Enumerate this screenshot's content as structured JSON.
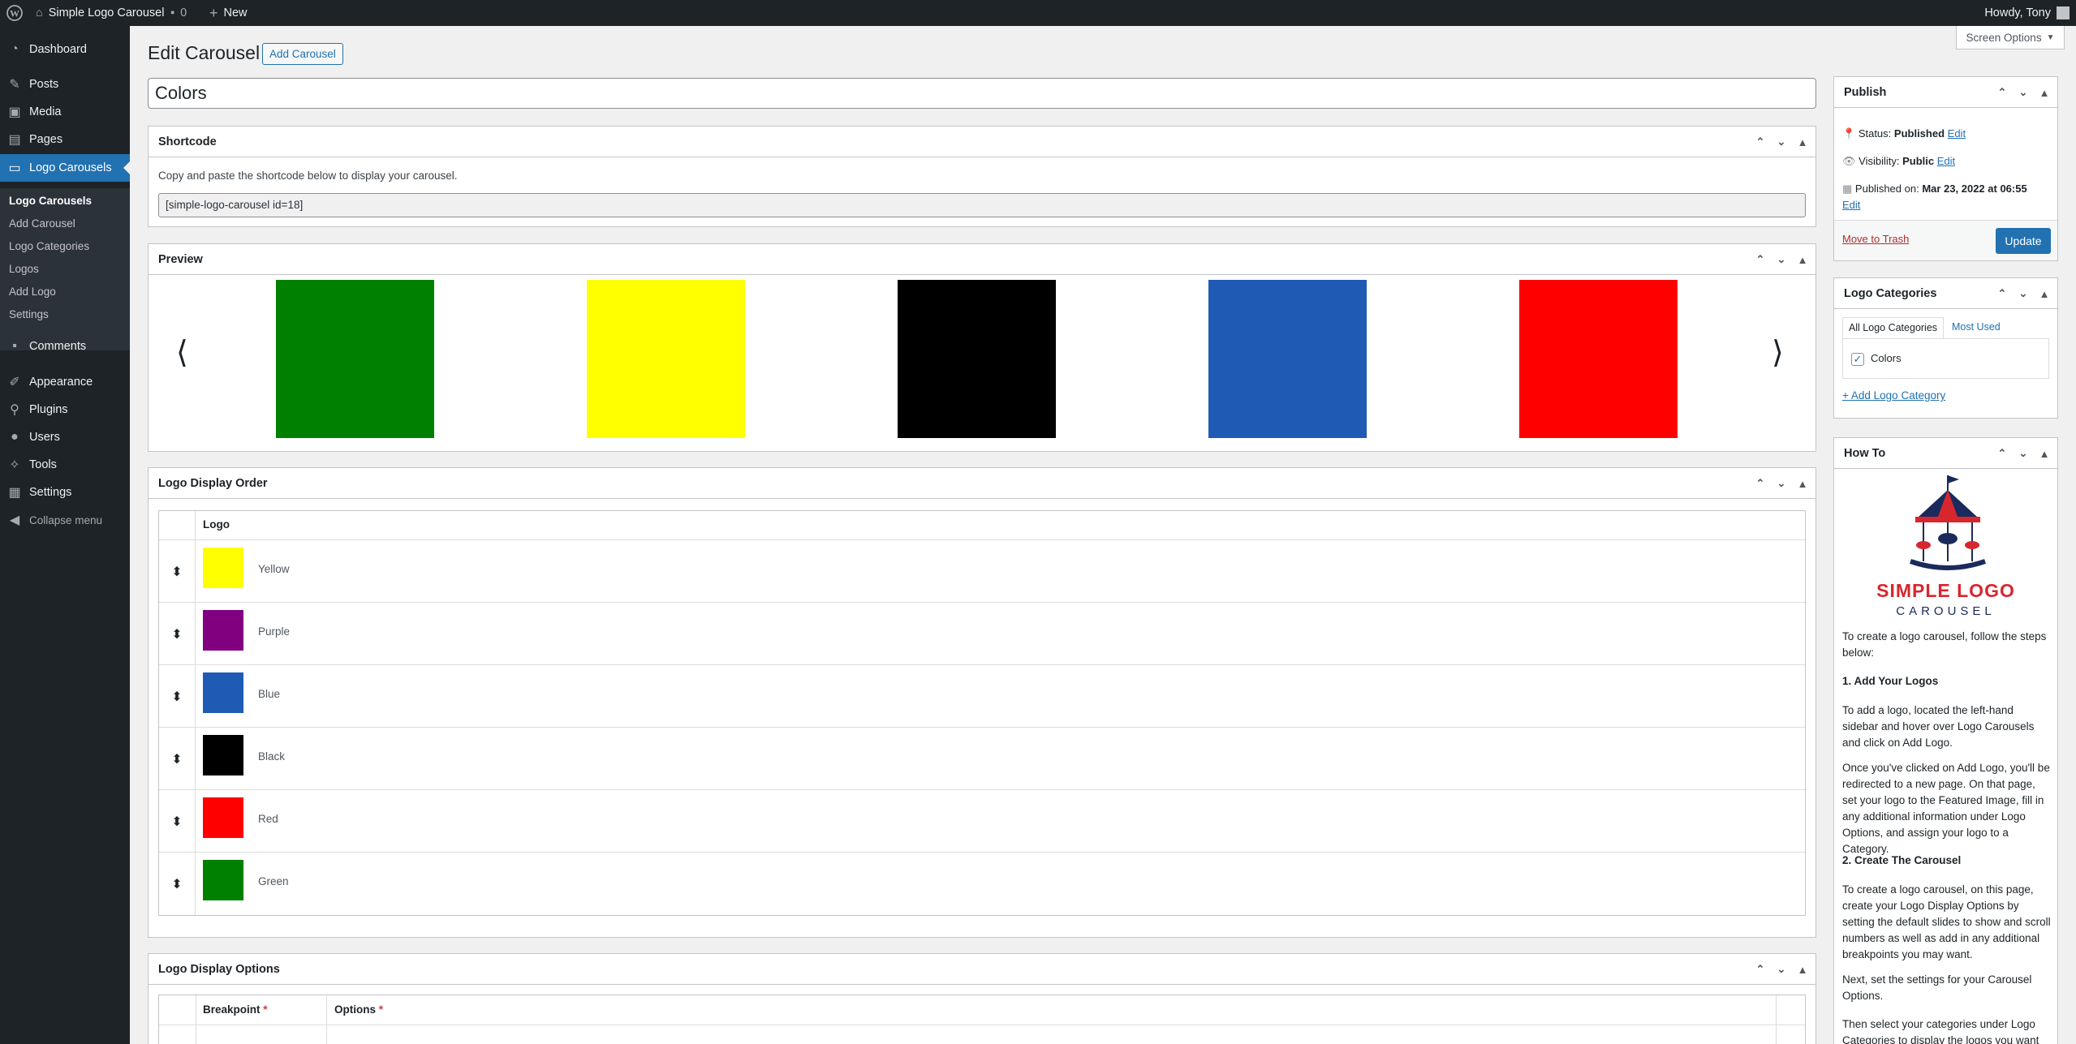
{
  "admin_bar": {
    "site_name": "Simple Logo Carousel",
    "comments_count": "0",
    "new_label": "New",
    "greeting": "Howdy, Tony"
  },
  "sidebar": {
    "items": [
      {
        "label": "Dashboard",
        "icon": "dashboard-icon"
      },
      {
        "label": "Posts",
        "icon": "pin-icon"
      },
      {
        "label": "Media",
        "icon": "media-icon"
      },
      {
        "label": "Pages",
        "icon": "pages-icon"
      },
      {
        "label": "Logo Carousels",
        "icon": "carousel-icon"
      },
      {
        "label": "Comments",
        "icon": "comment-icon"
      },
      {
        "label": "Appearance",
        "icon": "brush-icon"
      },
      {
        "label": "Plugins",
        "icon": "plugin-icon"
      },
      {
        "label": "Users",
        "icon": "user-icon"
      },
      {
        "label": "Tools",
        "icon": "wrench-icon"
      },
      {
        "label": "Settings",
        "icon": "settings-icon"
      },
      {
        "label": "Collapse menu",
        "icon": "collapse-icon"
      }
    ],
    "submenu": [
      "Logo Carousels",
      "Add Carousel",
      "Logo Categories",
      "Logos",
      "Add Logo",
      "Settings"
    ]
  },
  "screen_options": "Screen Options",
  "page": {
    "title": "Edit Carousel",
    "add_button": "Add Carousel",
    "post_title": "Colors"
  },
  "shortcode": {
    "heading": "Shortcode",
    "help": "Copy and paste the shortcode below to display your carousel.",
    "value": "[simple-logo-carousel id=18]"
  },
  "preview": {
    "heading": "Preview",
    "prev_glyph": "⟨",
    "next_glyph": "⟩",
    "colors": [
      "#008000",
      "#ffff00",
      "#000000",
      "#1f5bb5",
      "#ff0000"
    ]
  },
  "display_order": {
    "heading": "Logo Display Order",
    "column": "Logo",
    "rows": [
      {
        "label": "Yellow",
        "color": "#ffff00"
      },
      {
        "label": "Purple",
        "color": "#800080"
      },
      {
        "label": "Blue",
        "color": "#1f5bb5"
      },
      {
        "label": "Black",
        "color": "#000000"
      },
      {
        "label": "Red",
        "color": "#ff0000"
      },
      {
        "label": "Green",
        "color": "#008000"
      }
    ]
  },
  "display_options": {
    "heading": "Logo Display Options",
    "col_breakpoint": "Breakpoint",
    "col_options": "Options",
    "required_mark": "*"
  },
  "publish": {
    "heading": "Publish",
    "status_label": "Status:",
    "status_value": "Published",
    "visibility_label": "Visibility:",
    "visibility_value": "Public",
    "published_label": "Published on:",
    "published_value": "Mar 23, 2022 at 06:55",
    "edit": "Edit",
    "trash": "Move to Trash",
    "update": "Update"
  },
  "logo_categories": {
    "heading": "Logo Categories",
    "tab_all": "All Logo Categories",
    "tab_used": "Most Used",
    "category": "Colors",
    "add_link": "+ Add Logo Category"
  },
  "howto": {
    "heading": "How To",
    "logo_line1": "SIMPLE LOGO",
    "logo_line2": "CAROUSEL",
    "intro": "To create a logo carousel, follow the steps below:",
    "step1_title": "1. Add Your Logos",
    "step1_p1": "To add a logo, located the left-hand sidebar and hover over Logo Carousels and click on Add Logo.",
    "step1_p2": "Once you've clicked on Add Logo, you'll be redirected to a new page. On that page, set your logo to the Featured Image, fill in any additional information under Logo Options, and assign your logo to a Category.",
    "step2_title": "2. Create The Carousel",
    "step2_p1": "To create a logo carousel, on this page, create your Logo Display Options by setting the default slides to show and scroll numbers as well as add in any additional breakpoints you may want.",
    "step2_p2": "Next, set the settings for your Carousel Options.",
    "step2_p3": "Then select your categories under Logo Categories to display the logos you want to"
  }
}
